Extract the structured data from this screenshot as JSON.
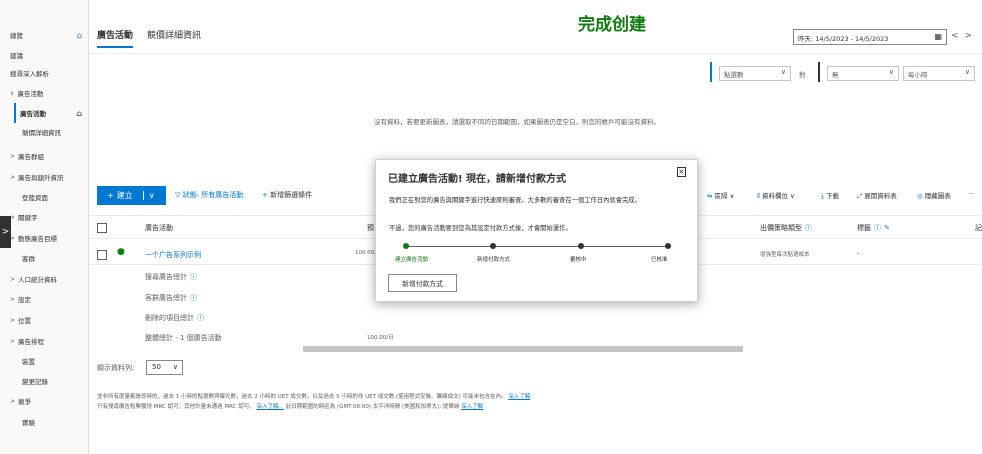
{
  "sidebar": {
    "items": [
      {
        "label": "總覽"
      },
      {
        "label": "建議"
      },
      {
        "label": "搜尋深入解析"
      },
      {
        "label": "廣告活動"
      },
      {
        "label": "廣告活動"
      },
      {
        "label": "競價詳細資訊"
      },
      {
        "label": "廣告群組"
      },
      {
        "label": "廣告與額外資訊"
      },
      {
        "label": "登陸頁面"
      },
      {
        "label": "關鍵字"
      },
      {
        "label": "動態廣告目標"
      },
      {
        "label": "客群"
      },
      {
        "label": "人口統計資料"
      },
      {
        "label": "設定"
      },
      {
        "label": "位置"
      },
      {
        "label": "廣告排程"
      },
      {
        "label": "裝置"
      },
      {
        "label": "變更記錄"
      },
      {
        "label": "競爭"
      },
      {
        "label": "實驗"
      }
    ]
  },
  "header": {
    "tabs": [
      {
        "label": "廣告活動"
      },
      {
        "label": "競價詳細資訊"
      }
    ],
    "overlay_text": "完成创建",
    "date_range": "昨天: 14/5/2023 - 14/5/2023",
    "prev": "<",
    "next": ">"
  },
  "chart_controls": {
    "metric1": "點選數",
    "vs": "對",
    "metric2": "無",
    "granularity": "每小時"
  },
  "no_data_message": "沒有資料，若要更新圖表，請選取不同的日期範圍，如果圖表仍是空白，則您的帳戶可能沒有資料。",
  "toolbar": {
    "create": "建立",
    "filter": "狀態: 所有廣告活動",
    "add_filter": "新增篩選條件",
    "segment": "區隔",
    "columns": "資料欄位",
    "download": "下載",
    "expand": "展開資料表",
    "hide_chart": "隱藏圖表",
    "more": "···"
  },
  "table": {
    "headers": {
      "campaign": "廣告活動",
      "budget": "預",
      "bid_strategy": "出價策略類型",
      "labels": "標籤",
      "last": "記"
    },
    "row": {
      "name": "一个广告系列示例",
      "budget": "100.00/",
      "bid_strategy": "增強型每次點選成本",
      "labels": "-"
    },
    "summary": [
      {
        "label": "搜尋廣告總計"
      },
      {
        "label": "客群廣告總計"
      },
      {
        "label": "刪除的項目總計"
      },
      {
        "label": "整體總計 - 1 個廣告活動",
        "value": "100.00/日"
      }
    ]
  },
  "pagination": {
    "label": "顯示資料列:",
    "value": "50"
  },
  "footer": {
    "line1_text": "並非所有度量都是即時的，過去 1 小時的點選數與曝光數，過去 2 小時的 UET 成交數，以及過去 5 小時的非 UET 成交數 (使用程式安裝、離線成交) 可能未包含在內。",
    "line1_link": "深入了解",
    "line2_text": "只有搜尋廣告點擊獲得 MRC 認可；其他計量未通過 MRC 認可。",
    "line2_link": "深入了解。",
    "line2_text_b": "此日期範圍的時區為 (GMT-08:00) 太平洋時間 (美國和加拿大); 提華納",
    "line2_link_b": "深入了解"
  },
  "modal": {
    "title": "已建立廣告活動! 現在，請新增付款方式",
    "body1": "我們正在對您的廣告與關鍵字進行快速原則審查。大多數的審查在一個工作日內就會完成。",
    "body2": "不過，您的廣告活動要到您為其設定付款方式後，才會開始運作。",
    "steps": [
      {
        "label": "建立廣告活動"
      },
      {
        "label": "新增付款方式"
      },
      {
        "label": "審核中"
      },
      {
        "label": "已核准"
      }
    ],
    "button": "新增付款方式",
    "close": "×"
  },
  "colors": {
    "accent": "#0078d4",
    "success": "#107c10"
  }
}
